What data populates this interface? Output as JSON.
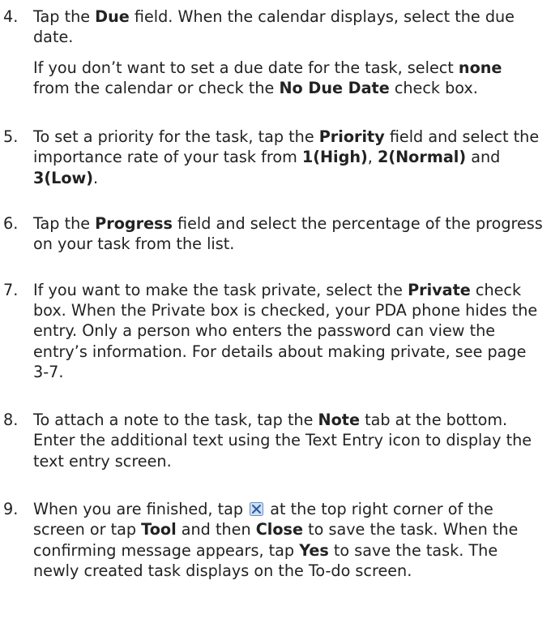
{
  "steps": [
    {
      "number": "4.",
      "paragraphs": [
        [
          {
            "t": "Tap the "
          },
          {
            "t": "Due",
            "b": true
          },
          {
            "t": " field. When the calendar displays, select the due date."
          }
        ],
        [
          {
            "t": "If you don’t want to set a due date for the task, select "
          },
          {
            "t": "none",
            "b": true
          },
          {
            "t": " from the calendar or check the "
          },
          {
            "t": "No Due Date",
            "b": true
          },
          {
            "t": " check box."
          }
        ]
      ]
    },
    {
      "number": "5.",
      "paragraphs": [
        [
          {
            "t": "To set a priority for the task, tap the "
          },
          {
            "t": "Priority",
            "b": true
          },
          {
            "t": " field and select the importance rate of your task from "
          },
          {
            "t": "1(High)",
            "b": true
          },
          {
            "t": ", "
          },
          {
            "t": "2(Normal)",
            "b": true
          },
          {
            "t": " and "
          },
          {
            "t": "3(Low)",
            "b": true
          },
          {
            "t": "."
          }
        ]
      ]
    },
    {
      "number": "6.",
      "paragraphs": [
        [
          {
            "t": "Tap the "
          },
          {
            "t": "Progress",
            "b": true
          },
          {
            "t": " field and select the percentage of the progress on your task from the list."
          }
        ]
      ]
    },
    {
      "number": "7.",
      "paragraphs": [
        [
          {
            "t": "If you want to make the task private, select the "
          },
          {
            "t": "Private",
            "b": true
          },
          {
            "t": " check box. When the Private box is checked, your PDA phone hides the entry. Only a person who enters the password can view the entry’s information. For details about making private, see page 3-7."
          }
        ]
      ]
    },
    {
      "number": "8.",
      "paragraphs": [
        [
          {
            "t": "To attach a note to the task, tap the "
          },
          {
            "t": "Note",
            "b": true
          },
          {
            "t": " tab at the bottom. Enter the additional text using the Text Entry icon to display the text entry screen."
          }
        ]
      ]
    },
    {
      "number": "9.",
      "paragraphs": [
        [
          {
            "t": "When you are finished, tap "
          },
          {
            "icon": "close-icon"
          },
          {
            "t": " at the top right corner of the screen or tap "
          },
          {
            "t": "Tool",
            "b": true
          },
          {
            "t": " and then "
          },
          {
            "t": "Close",
            "b": true
          },
          {
            "t": " to save the task. When the confirming message appears, tap "
          },
          {
            "t": "Yes",
            "b": true
          },
          {
            "t": " to save the task. The newly created task displays on the To-do screen."
          }
        ]
      ]
    }
  ],
  "colors": {
    "text": "#222222",
    "close_icon_bg": "#cfe0f3",
    "close_icon_border": "#6b8fbf",
    "close_icon_x": "#2a5aa0"
  }
}
